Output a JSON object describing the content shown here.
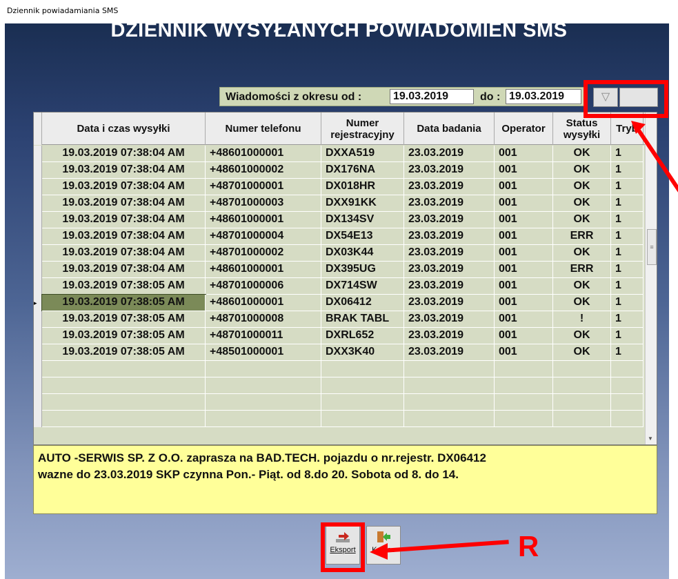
{
  "window": {
    "title": "Dziennik powiadamiania SMS"
  },
  "main_title": "DZIENNIK WYSYŁANYCH POWIADOMIEŃ SMS",
  "period": {
    "label": "Wiadomości z okresu od :",
    "from": "19.03.2019",
    "to_label": "do :",
    "to": "19.03.2019"
  },
  "filter_icon": "filter-icon",
  "grid": {
    "columns": [
      "Data i czas wysyłki",
      "Numer telefonu",
      "Numer rejestracyjny",
      "Data badania",
      "Operator",
      "Status wysyłki",
      "Tryb"
    ],
    "rows": [
      [
        "19.03.2019 07:38:04 AM",
        "+48601000001",
        "DXXA519",
        "23.03.2019",
        "001",
        "OK",
        "1"
      ],
      [
        "19.03.2019 07:38:04 AM",
        "+48601000002",
        "DX176NA",
        "23.03.2019",
        "001",
        "OK",
        "1"
      ],
      [
        "19.03.2019 07:38:04 AM",
        "+48701000001",
        "DX018HR",
        "23.03.2019",
        "001",
        "OK",
        "1"
      ],
      [
        "19.03.2019 07:38:04 AM",
        "+48701000003",
        "DXX91KK",
        "23.03.2019",
        "001",
        "OK",
        "1"
      ],
      [
        "19.03.2019 07:38:04 AM",
        "+48601000001",
        "DX134SV",
        "23.03.2019",
        "001",
        "OK",
        "1"
      ],
      [
        "19.03.2019 07:38:04 AM",
        "+48701000004",
        "DX54E13",
        "23.03.2019",
        "001",
        "ERR",
        "1"
      ],
      [
        "19.03.2019 07:38:04 AM",
        "+48701000002",
        "DX03K44",
        "23.03.2019",
        "001",
        "OK",
        "1"
      ],
      [
        "19.03.2019 07:38:04 AM",
        "+48601000001",
        "DX395UG",
        "23.03.2019",
        "001",
        "ERR",
        "1"
      ],
      [
        "19.03.2019 07:38:05 AM",
        "+48701000006",
        "DX714SW",
        "23.03.2019",
        "001",
        "OK",
        "1"
      ],
      [
        "19.03.2019 07:38:05 AM",
        "+48601000001",
        "DX06412",
        "23.03.2019",
        "001",
        "OK",
        "1"
      ],
      [
        "19.03.2019 07:38:05 AM",
        "+48701000008",
        "BRAK TABL",
        "23.03.2019",
        "001",
        "!",
        "1"
      ],
      [
        "19.03.2019 07:38:05 AM",
        "+48701000011",
        "DXRL652",
        "23.03.2019",
        "001",
        "OK",
        "1"
      ],
      [
        "19.03.2019 07:38:05 AM",
        "+48501000001",
        "DXX3K40",
        "23.03.2019",
        "001",
        "OK",
        "1"
      ]
    ],
    "selected_row": 9,
    "row_selector_marker": "▸"
  },
  "message": {
    "line1": "AUTO -SERWIS SP. Z O.O. zaprasza na BAD.TECH. pojazdu o nr.rejestr. DX06412",
    "line2": "wazne do 23.03.2019  SKP czynna Pon.- Piąt. od 8.do 20. Sobota od 8. do 14."
  },
  "buttons": {
    "export_label": "Eksport",
    "exit_label": "Koniec"
  },
  "annotation": {
    "letter": "R",
    "color": "#ff0000"
  },
  "colors": {
    "accent_red": "#ff0000",
    "row_bg": "#d6dcc4",
    "selected_bg": "#7b8a58",
    "message_bg": "#ffff99"
  }
}
